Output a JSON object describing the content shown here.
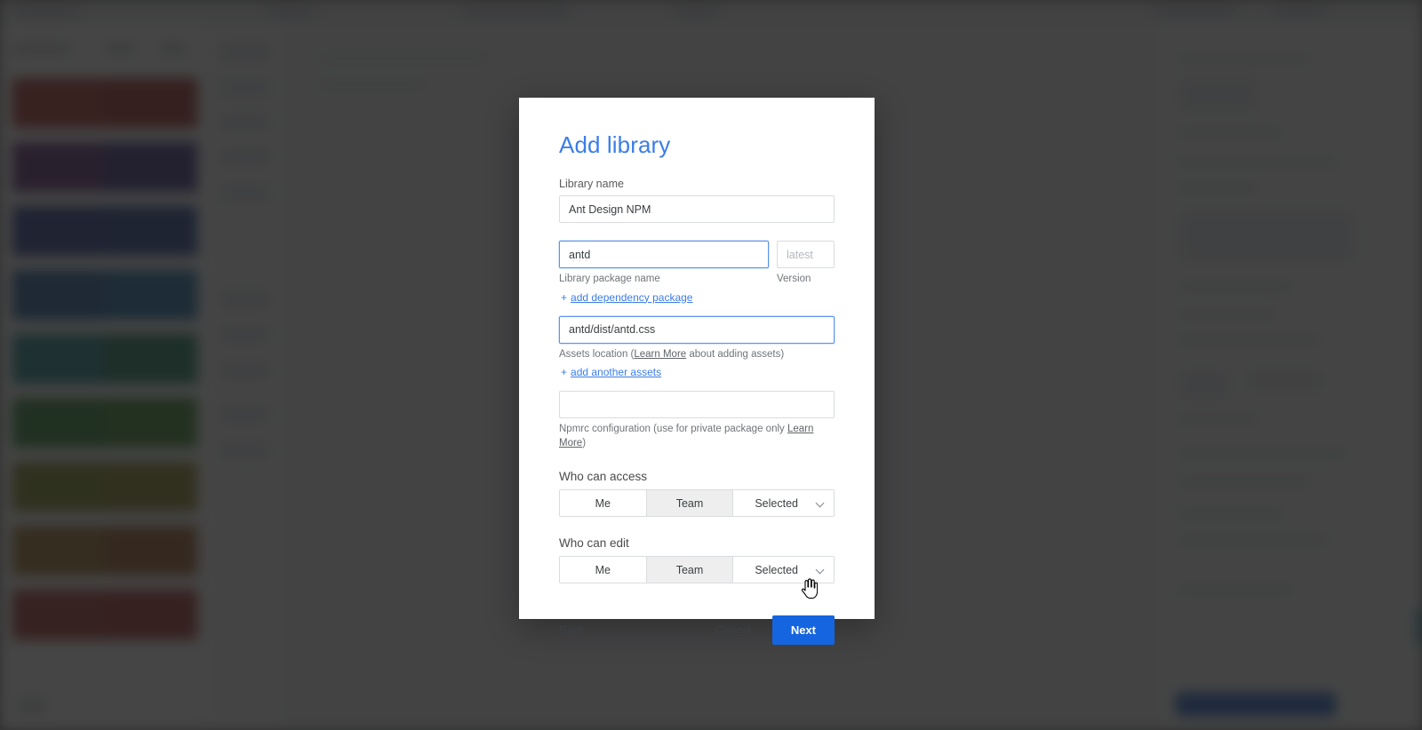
{
  "modal": {
    "title": "Add library",
    "library_name": {
      "label": "Library name",
      "value": "Ant Design NPM"
    },
    "package": {
      "name_value": "antd",
      "name_hint": "Library package name",
      "version_placeholder": "latest",
      "version_label": "Version",
      "add_dependency_link": "add dependency package",
      "plus": "+"
    },
    "assets": {
      "value": "antd/dist/antd.css",
      "hint_prefix": "Assets location (",
      "hint_link": "Learn More",
      "hint_suffix": " about adding assets)",
      "add_another_link": "add another assets"
    },
    "npmrc": {
      "value": "",
      "hint_prefix": "Npmrc configuration (use for private package only ",
      "hint_link": "Learn More",
      "hint_suffix": ")"
    },
    "who_can_access": {
      "label": "Who can access",
      "options": [
        "Me",
        "Team",
        "Selected"
      ],
      "selected": "Team"
    },
    "who_can_edit": {
      "label": "Who can edit",
      "options": [
        "Me",
        "Team",
        "Selected"
      ],
      "selected": "Team"
    },
    "footer": {
      "back": "Back",
      "cancel": "Cancel",
      "next": "Next"
    }
  },
  "colors": {
    "title_blue": "#3b7de8",
    "primary_button": "#1565e0",
    "link_blue": "#3b7de8",
    "active_segment": "#eeeeee",
    "focus_border": "#5b94ea",
    "spellcheck_red": "#e0534a"
  },
  "background": {
    "swatch_rows": [
      [
        "#b8443c",
        "#a93b36"
      ],
      [
        "#6d3f86",
        "#4a3f8e"
      ],
      [
        "#3b4a9e",
        "#33539e"
      ],
      [
        "#2f6aa8",
        "#2f7bb4"
      ],
      [
        "#2f8f93",
        "#2f8a6d"
      ],
      [
        "#3f8f43",
        "#4d9440"
      ],
      [
        "#8d9339",
        "#96903a"
      ],
      [
        "#a8803a",
        "#a9693a"
      ],
      [
        "#b0463e",
        "#b03f3c"
      ]
    ]
  }
}
